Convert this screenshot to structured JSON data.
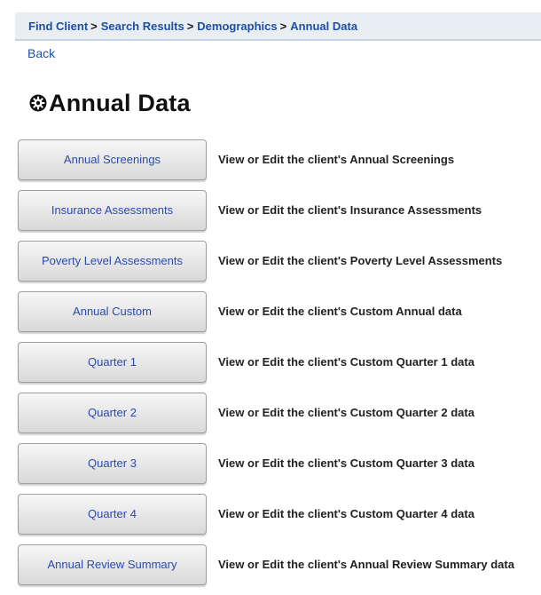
{
  "breadcrumb": {
    "items": [
      {
        "label": "Find Client"
      },
      {
        "label": "Search Results"
      },
      {
        "label": "Demographics"
      },
      {
        "label": "Annual Data"
      }
    ],
    "separator": ">"
  },
  "nav": {
    "back_label": "Back"
  },
  "page": {
    "title": "Annual Data",
    "title_icon": "gear-icon"
  },
  "actions": [
    {
      "button": "Annual Screenings",
      "description": "View or Edit the client's Annual Screenings"
    },
    {
      "button": "Insurance Assessments",
      "description": "View or Edit the client's Insurance Assessments"
    },
    {
      "button": "Poverty Level Assessments",
      "description": "View or Edit the client's Poverty Level Assessments"
    },
    {
      "button": "Annual Custom",
      "description": "View or Edit the client's Custom Annual data"
    },
    {
      "button": "Quarter 1",
      "description": "View or Edit the client's Custom Quarter 1 data"
    },
    {
      "button": "Quarter 2",
      "description": "View or Edit the client's Custom Quarter 2 data"
    },
    {
      "button": "Quarter 3",
      "description": "View or Edit the client's Custom Quarter 3 data"
    },
    {
      "button": "Quarter 4",
      "description": "View or Edit the client's Custom Quarter 4 data"
    },
    {
      "button": "Annual Review Summary",
      "description": "View or Edit the client's Annual Review Summary data"
    }
  ],
  "colors": {
    "link": "#1f4fa3",
    "button_text": "#2b4ab0",
    "breadcrumb_bg": "#e9eef3"
  }
}
